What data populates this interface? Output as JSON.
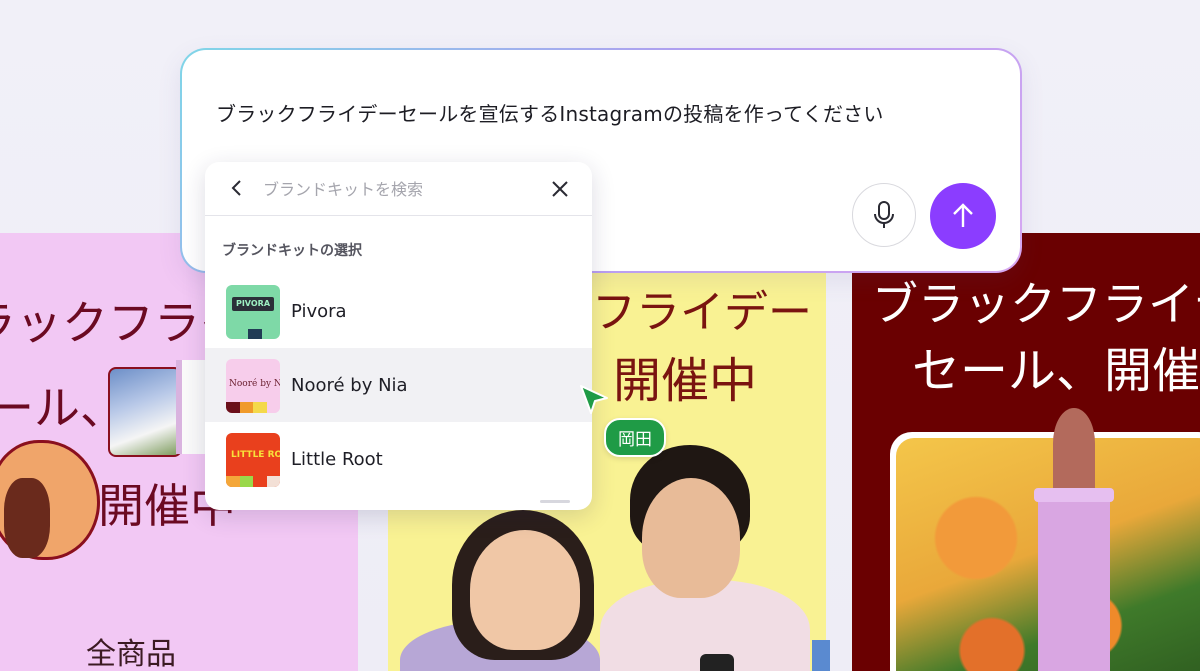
{
  "prompt": {
    "text": "ブラックフライデーセールを宣伝するInstagramの投稿を作ってください"
  },
  "dropdown": {
    "search_placeholder": "ブランドキットを検索",
    "section_title": "ブランドキットの選択",
    "kits": [
      {
        "name": "Pivora",
        "logo_text": "PIVORA",
        "selected": false
      },
      {
        "name": "Nooré by Nia",
        "logo_text": "Nooré by Nia",
        "selected": true
      },
      {
        "name": "Little Root",
        "logo_text": "LITTLE ROOT",
        "selected": false
      }
    ]
  },
  "collaborator": {
    "name": "岡田",
    "color": "#1f9b46"
  },
  "background_designs": {
    "left": {
      "line1": "ラックフライ",
      "line2": "ール、",
      "line3": "開催中",
      "line4": "全商品"
    },
    "middle": {
      "line1": "フライデー",
      "line2": "開催中"
    },
    "right": {
      "line1": "ブラックフライデ",
      "line2": "セール、開催中"
    }
  },
  "icons": {
    "back": "chevron-left-icon",
    "close": "close-icon",
    "mic": "microphone-icon",
    "send": "arrow-up-icon",
    "cursor": "pointer-cursor-icon"
  },
  "colors": {
    "accent": "#8b3dff",
    "collaborator": "#1f9b46",
    "card_left_bg": "#f2c8f4",
    "card_mid_bg": "#f9f293",
    "card_right_bg": "#6a0001"
  }
}
